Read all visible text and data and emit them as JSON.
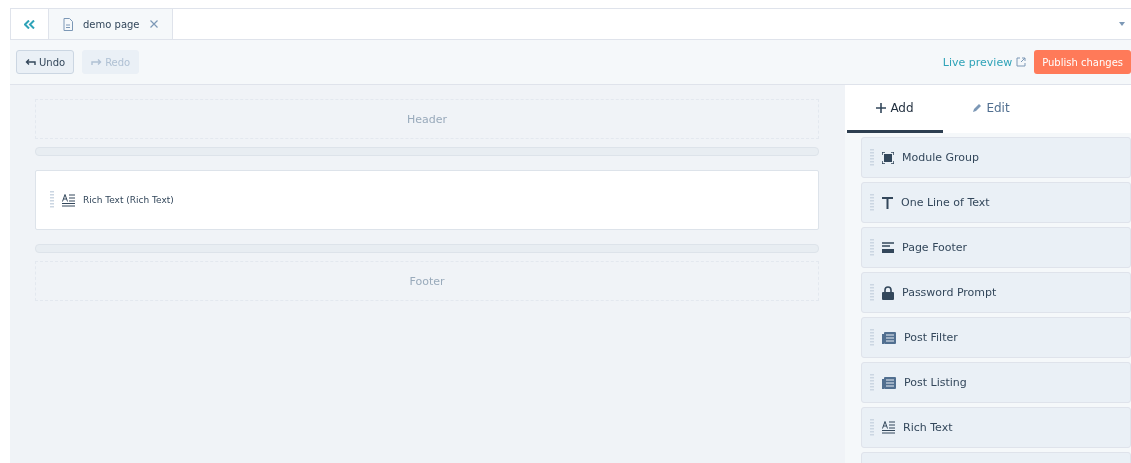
{
  "tabs": [
    {
      "label": "demo page",
      "selected": true
    }
  ],
  "toolbar": {
    "buttons": [
      {
        "label": "Undo",
        "kind": "undo",
        "disabled": false
      },
      {
        "label": "Redo",
        "kind": "redo",
        "disabled": true
      }
    ],
    "live_preview": "Live preview",
    "publish": "Publish changes"
  },
  "canvas": {
    "sections": [
      {
        "kind": "placeholder",
        "label": "Header"
      },
      {
        "kind": "module",
        "label": "Rich Text (Rich Text)"
      },
      {
        "kind": "placeholder",
        "label": "Footer"
      }
    ]
  },
  "panel": {
    "tabs": [
      {
        "label": "Add",
        "kind": "add",
        "selected": true
      },
      {
        "label": "Edit",
        "kind": "edit",
        "selected": false
      }
    ],
    "modules": [
      {
        "label": "Module Group",
        "kind": "group"
      },
      {
        "label": "One Line of Text",
        "kind": "text"
      },
      {
        "label": "Page Footer",
        "kind": "footer"
      },
      {
        "label": "Password Prompt",
        "kind": "lock"
      },
      {
        "label": "Post Filter",
        "kind": "post"
      },
      {
        "label": "Post Listing",
        "kind": "post"
      },
      {
        "label": "Rich Text",
        "kind": "rich"
      }
    ]
  }
}
